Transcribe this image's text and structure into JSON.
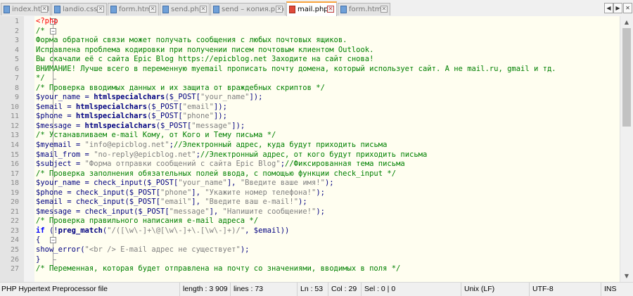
{
  "tabs": [
    {
      "label": "index.html",
      "active": false
    },
    {
      "label": "landio.css",
      "active": false
    },
    {
      "label": "form.html",
      "active": false
    },
    {
      "label": "send.php",
      "active": false
    },
    {
      "label": "send – копия.php",
      "active": false
    },
    {
      "label": "mail.php",
      "active": true
    },
    {
      "label": "form.html",
      "active": false
    }
  ],
  "tab_close_symbol": "✕",
  "nav": {
    "prev": "◀",
    "next": "▶",
    "close": "✕"
  },
  "scroll": {
    "up": "▲",
    "down": "▼"
  },
  "fold": {
    "minus": "−"
  },
  "lines": [
    {
      "n": "1",
      "tokens": [
        {
          "t": "<?php",
          "c": "php"
        }
      ]
    },
    {
      "n": "2",
      "tokens": [
        {
          "t": "/*",
          "c": "cm"
        }
      ]
    },
    {
      "n": "3",
      "tokens": [
        {
          "t": "Форма обратной связи может получать сообщения с любых почтовых ящиков.",
          "c": "cm"
        }
      ]
    },
    {
      "n": "4",
      "tokens": [
        {
          "t": "Исправлена проблема кодировки при получении писем почтовым клиентом Outlook.",
          "c": "cm"
        }
      ]
    },
    {
      "n": "5",
      "tokens": [
        {
          "t": "Вы скачали её с сайта Epic Blog ",
          "c": "cm"
        },
        {
          "t": "https://epicblog.net",
          "c": "cm",
          "link": true
        },
        {
          "t": " Заходите на сайт снова!",
          "c": "cm"
        }
      ]
    },
    {
      "n": "6",
      "tokens": [
        {
          "t": "ВНИМАНИЕ! Лучше всего в переменную myemail прописать почту домена, который использует сайт. А не mail.ru, gmail и тд.",
          "c": "cm"
        }
      ]
    },
    {
      "n": "7",
      "tokens": [
        {
          "t": "*/",
          "c": "cm"
        }
      ]
    },
    {
      "n": "8",
      "tokens": [
        {
          "t": "/* Проверка вводимых данных и их защита от враждебных скриптов */",
          "c": "cm"
        }
      ]
    },
    {
      "n": "9",
      "tokens": [
        {
          "t": "$your_name",
          "c": "var"
        },
        {
          "t": " = ",
          "c": "op"
        },
        {
          "t": "htmlspecialchars",
          "c": "fn"
        },
        {
          "t": "(",
          "c": "op"
        },
        {
          "t": "$_POST",
          "c": "var"
        },
        {
          "t": "[",
          "c": "op"
        },
        {
          "t": "\"your_name\"",
          "c": "str"
        },
        {
          "t": "]);",
          "c": "op"
        }
      ]
    },
    {
      "n": "10",
      "tokens": [
        {
          "t": "$email",
          "c": "var"
        },
        {
          "t": " = ",
          "c": "op"
        },
        {
          "t": "htmlspecialchars",
          "c": "fn"
        },
        {
          "t": "(",
          "c": "op"
        },
        {
          "t": "$_POST",
          "c": "var"
        },
        {
          "t": "[",
          "c": "op"
        },
        {
          "t": "\"email\"",
          "c": "str"
        },
        {
          "t": "]);",
          "c": "op"
        }
      ]
    },
    {
      "n": "11",
      "tokens": [
        {
          "t": "$phone",
          "c": "var"
        },
        {
          "t": " = ",
          "c": "op"
        },
        {
          "t": "htmlspecialchars",
          "c": "fn"
        },
        {
          "t": "(",
          "c": "op"
        },
        {
          "t": "$_POST",
          "c": "var"
        },
        {
          "t": "[",
          "c": "op"
        },
        {
          "t": "\"phone\"",
          "c": "str"
        },
        {
          "t": "]);",
          "c": "op"
        }
      ]
    },
    {
      "n": "12",
      "tokens": [
        {
          "t": "$message",
          "c": "var"
        },
        {
          "t": " = ",
          "c": "op"
        },
        {
          "t": "htmlspecialchars",
          "c": "fn"
        },
        {
          "t": "(",
          "c": "op"
        },
        {
          "t": "$_POST",
          "c": "var"
        },
        {
          "t": "[",
          "c": "op"
        },
        {
          "t": "\"message\"",
          "c": "str"
        },
        {
          "t": "]);",
          "c": "op"
        }
      ]
    },
    {
      "n": "13",
      "tokens": [
        {
          "t": "/* Устанавливаем e-mail Кому, от Кого и Тему письма */",
          "c": "cm"
        }
      ]
    },
    {
      "n": "14",
      "tokens": [
        {
          "t": "$myemail",
          "c": "var"
        },
        {
          "t": " = ",
          "c": "op"
        },
        {
          "t": "\"info@epicblog.net\"",
          "c": "str"
        },
        {
          "t": ";",
          "c": "op"
        },
        {
          "t": "//Электронный адрес, куда будут приходить письма",
          "c": "cm"
        }
      ]
    },
    {
      "n": "15",
      "tokens": [
        {
          "t": "$mail_from",
          "c": "var"
        },
        {
          "t": " = ",
          "c": "op"
        },
        {
          "t": "\"no-reply@epicblog.net\"",
          "c": "str"
        },
        {
          "t": ";",
          "c": "op"
        },
        {
          "t": "//Электронный адрес, от кого будут приходить письма",
          "c": "cm"
        }
      ]
    },
    {
      "n": "16",
      "tokens": [
        {
          "t": "$subject",
          "c": "var"
        },
        {
          "t": " = ",
          "c": "op"
        },
        {
          "t": "\"Форма отправки сообщений с сайта Epic Blog\"",
          "c": "str"
        },
        {
          "t": ";",
          "c": "op"
        },
        {
          "t": "//Фиксированная тема письма",
          "c": "cm"
        }
      ]
    },
    {
      "n": "17",
      "tokens": [
        {
          "t": "/* Проверка заполнения обязательных полей ввода, с помощью функции check_input */",
          "c": "cm"
        }
      ]
    },
    {
      "n": "18",
      "tokens": [
        {
          "t": "$your_name",
          "c": "var"
        },
        {
          "t": " = check_input(",
          "c": "op"
        },
        {
          "t": "$_POST",
          "c": "var"
        },
        {
          "t": "[",
          "c": "op"
        },
        {
          "t": "\"your_name\"",
          "c": "str"
        },
        {
          "t": "], ",
          "c": "op"
        },
        {
          "t": "\"Введите ваше имя!\"",
          "c": "str"
        },
        {
          "t": ");",
          "c": "op"
        }
      ]
    },
    {
      "n": "19",
      "tokens": [
        {
          "t": "$phone",
          "c": "var"
        },
        {
          "t": " = check_input(",
          "c": "op"
        },
        {
          "t": "$_POST",
          "c": "var"
        },
        {
          "t": "[",
          "c": "op"
        },
        {
          "t": "\"phone\"",
          "c": "str"
        },
        {
          "t": "], ",
          "c": "op"
        },
        {
          "t": "\"Укажите номер телефона!\"",
          "c": "str"
        },
        {
          "t": ");",
          "c": "op"
        }
      ]
    },
    {
      "n": "20",
      "tokens": [
        {
          "t": "$email",
          "c": "var"
        },
        {
          "t": " = check_input(",
          "c": "op"
        },
        {
          "t": "$_POST",
          "c": "var"
        },
        {
          "t": "[",
          "c": "op"
        },
        {
          "t": "\"email\"",
          "c": "str"
        },
        {
          "t": "], ",
          "c": "op"
        },
        {
          "t": "\"Введите ваш e-mail!\"",
          "c": "str"
        },
        {
          "t": ");",
          "c": "op"
        }
      ]
    },
    {
      "n": "21",
      "tokens": [
        {
          "t": "$message",
          "c": "var"
        },
        {
          "t": " = check_input(",
          "c": "op"
        },
        {
          "t": "$_POST",
          "c": "var"
        },
        {
          "t": "[",
          "c": "op"
        },
        {
          "t": "\"message\"",
          "c": "str"
        },
        {
          "t": "], ",
          "c": "op"
        },
        {
          "t": "\"Напишите сообщение!\"",
          "c": "str"
        },
        {
          "t": ");",
          "c": "op"
        }
      ]
    },
    {
      "n": "22",
      "tokens": [
        {
          "t": "/* Проверка правильного написания e-mail адреса */",
          "c": "cm"
        }
      ]
    },
    {
      "n": "23",
      "tokens": [
        {
          "t": "if",
          "c": "kw"
        },
        {
          "t": " (!",
          "c": "op"
        },
        {
          "t": "preg_match",
          "c": "fn"
        },
        {
          "t": "(",
          "c": "op"
        },
        {
          "t": "\"/([\\w\\-]+\\@[\\w\\-]+\\.[\\w\\-]+)/\"",
          "c": "str"
        },
        {
          "t": ", ",
          "c": "op"
        },
        {
          "t": "$email",
          "c": "var"
        },
        {
          "t": "))",
          "c": "op"
        }
      ]
    },
    {
      "n": "24",
      "tokens": [
        {
          "t": "{",
          "c": "op"
        }
      ]
    },
    {
      "n": "25",
      "tokens": [
        {
          "t": "show_error(",
          "c": "op"
        },
        {
          "t": "\"<br /> E-mail адрес не существует\"",
          "c": "str"
        },
        {
          "t": ");",
          "c": "op"
        }
      ]
    },
    {
      "n": "26",
      "tokens": [
        {
          "t": "}",
          "c": "op"
        }
      ]
    },
    {
      "n": "27",
      "tokens": [
        {
          "t": "/* Переменная, которая будет отправлена на почту со значениями, вводимых в поля */",
          "c": "cm"
        }
      ]
    }
  ],
  "status": {
    "language": "PHP Hypertext Preprocessor file",
    "length": "length : 3 909",
    "lines": "lines : 73",
    "ln": "Ln : 53",
    "col": "Col : 29",
    "sel": "Sel : 0 | 0",
    "eol": "Unix (LF)",
    "encoding": "UTF-8",
    "mode": "INS"
  }
}
